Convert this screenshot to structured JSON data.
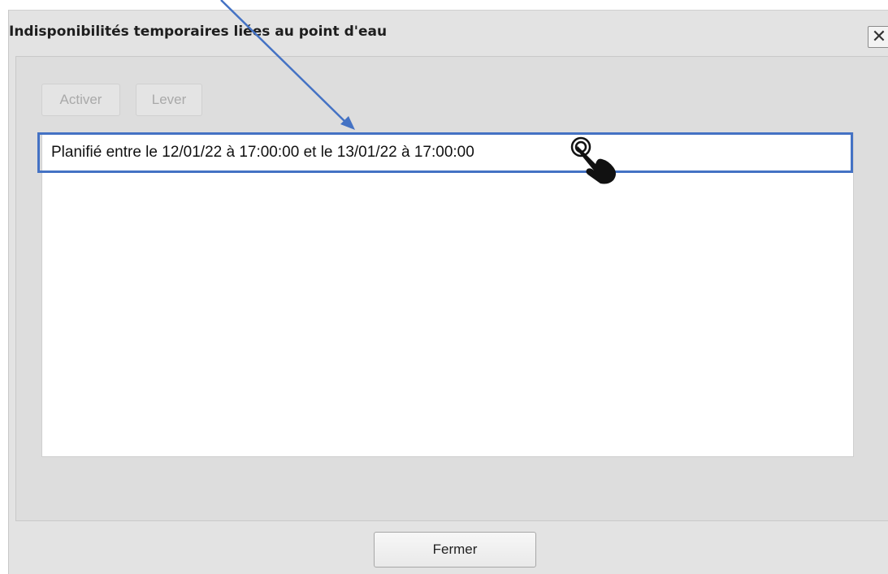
{
  "window": {
    "title": "Indisponibilités temporaires liées au point d'eau",
    "close_glyph": "✕"
  },
  "toolbar": {
    "activate_label": "Activer",
    "lift_label": "Lever"
  },
  "list": {
    "items": [
      {
        "label": "Planifié entre le 12/01/22 à 17:00:00 et le 13/01/22 à 17:00:00"
      }
    ]
  },
  "footer": {
    "close_label": "Fermer"
  },
  "colors": {
    "highlight": "#4472c4",
    "arrow": "#4472c4"
  },
  "icons": {
    "cursor": "hand-pointer-icon",
    "annotation": "annotation-arrow-icon"
  }
}
